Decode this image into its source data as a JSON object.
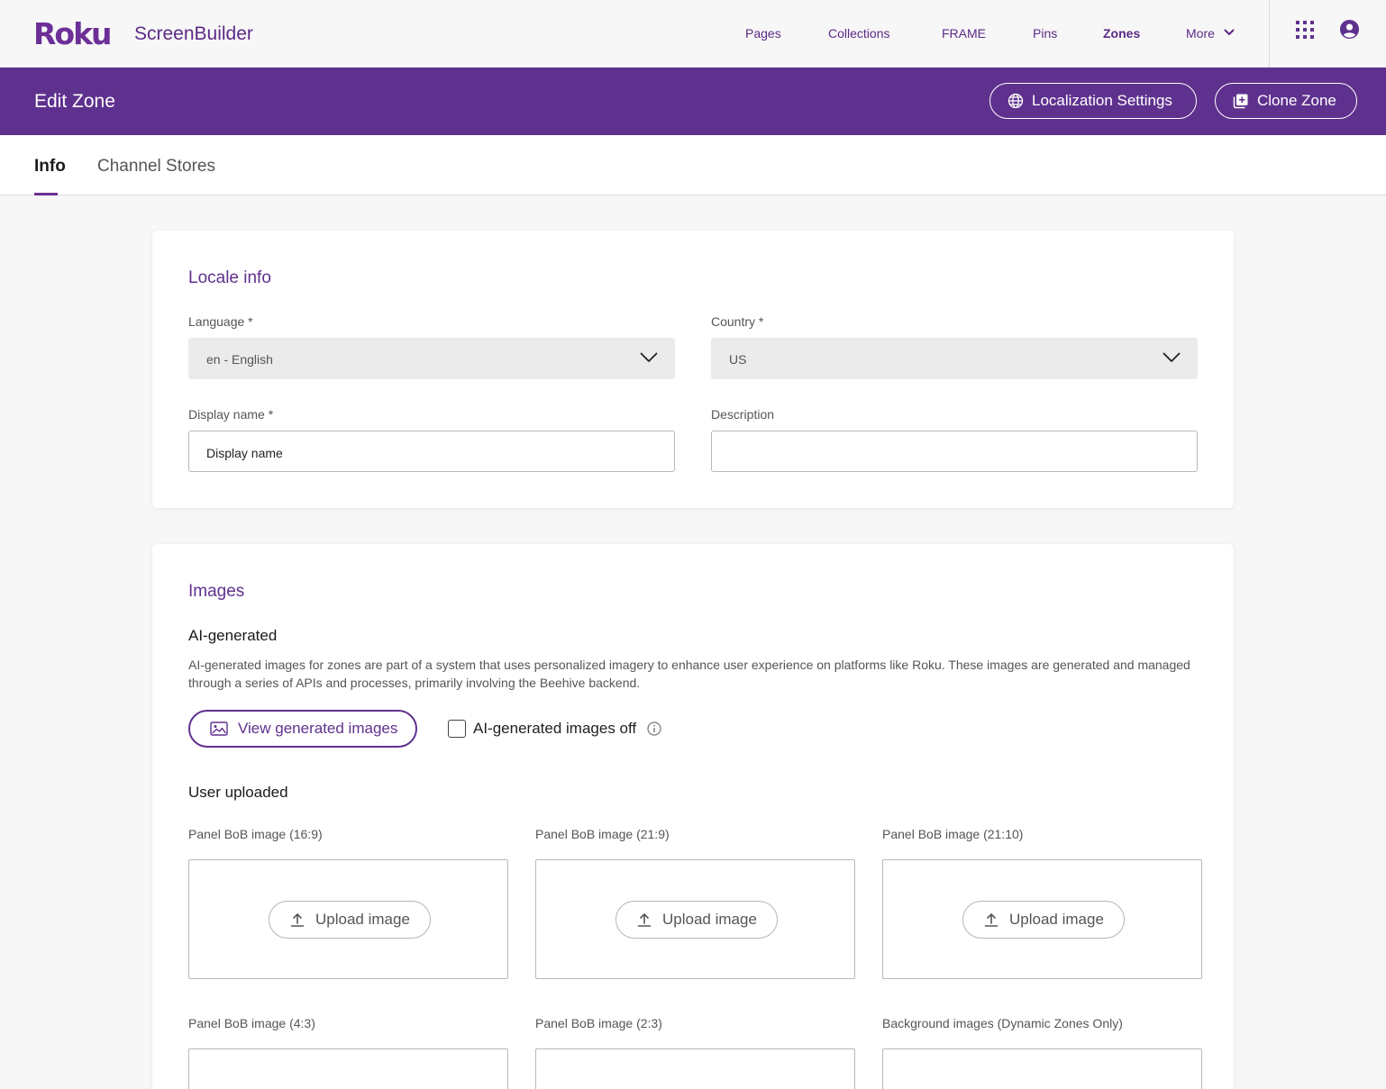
{
  "topnav": {
    "logo": "Roku",
    "app_name": "ScreenBuilder",
    "links": [
      "Pages",
      "Collections",
      "FRAME",
      "Pins",
      "Zones",
      "More"
    ],
    "active_link": "Zones",
    "icons": [
      "chevron-down-icon",
      "apps-grid-icon",
      "account-icon"
    ]
  },
  "header": {
    "title": "Edit Zone",
    "localization_button": "Localization Settings",
    "clone_button": "Clone Zone",
    "background_color": "#5f318e"
  },
  "tabs": {
    "info": "Info",
    "channel_stores": "Channel Stores",
    "active": "Info"
  },
  "locale": {
    "title": "Locale info",
    "language_label": "Language *",
    "language_value": "en - English",
    "country_label": "Country *",
    "country_value": "US",
    "display_name_label": "Display name *",
    "display_name_value": "Display name",
    "description_label": "Description",
    "description_value": ""
  },
  "images": {
    "title": "Images",
    "ai_heading": "AI-generated",
    "ai_description": "AI-generated images for zones are part of a system that uses personalized imagery to enhance user experience on platforms like Roku. These images are generated and managed through a series of APIs and processes, primarily involving the Beehive backend.",
    "view_button": "View generated images",
    "ai_off_label": "AI-generated images off",
    "ai_off_checked": false,
    "user_heading": "User uploaded",
    "upload_button": "Upload image",
    "slots": [
      "Panel BoB image (16:9)",
      "Panel BoB image (21:9)",
      "Panel BoB image (21:10)",
      "Panel BoB image (4:3)",
      "Panel BoB image (2:3)",
      "Background images (Dynamic Zones Only)"
    ]
  },
  "colors": {
    "accent": "#5f318e",
    "nav_text": "#5b2a86",
    "page_background": "#f7f7f7"
  }
}
